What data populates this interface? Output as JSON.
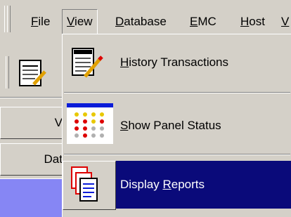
{
  "menubar": {
    "items": [
      {
        "label": "File",
        "underline": "F",
        "rest": "ile"
      },
      {
        "label": "View",
        "underline": "V",
        "rest": "iew"
      },
      {
        "label": "Database",
        "underline": "D",
        "rest": "atabase"
      },
      {
        "label": "EMC",
        "underline": "E",
        "rest": "MC"
      },
      {
        "label": "Host",
        "underline": "H",
        "rest": "ost"
      },
      {
        "label": "V",
        "underline": "V",
        "rest": ""
      }
    ]
  },
  "sidebar": {
    "button1_text": "V",
    "button2_text": "Dat"
  },
  "view_menu": {
    "items": [
      {
        "pre": "",
        "underline": "H",
        "post": "istory Transactions",
        "icon": "history-icon"
      },
      {
        "pre": "",
        "underline": "S",
        "post": "how Panel Status",
        "icon": "panel-status-icon"
      },
      {
        "pre": "Display ",
        "underline": "R",
        "post": "eports",
        "icon": "reports-icon"
      }
    ],
    "selected_index": 2
  },
  "colors": {
    "face": "#d4d0c8",
    "highlight": "#0a0a7a",
    "panel_bar": "#0a1cd8",
    "purple": "#8686f4"
  }
}
